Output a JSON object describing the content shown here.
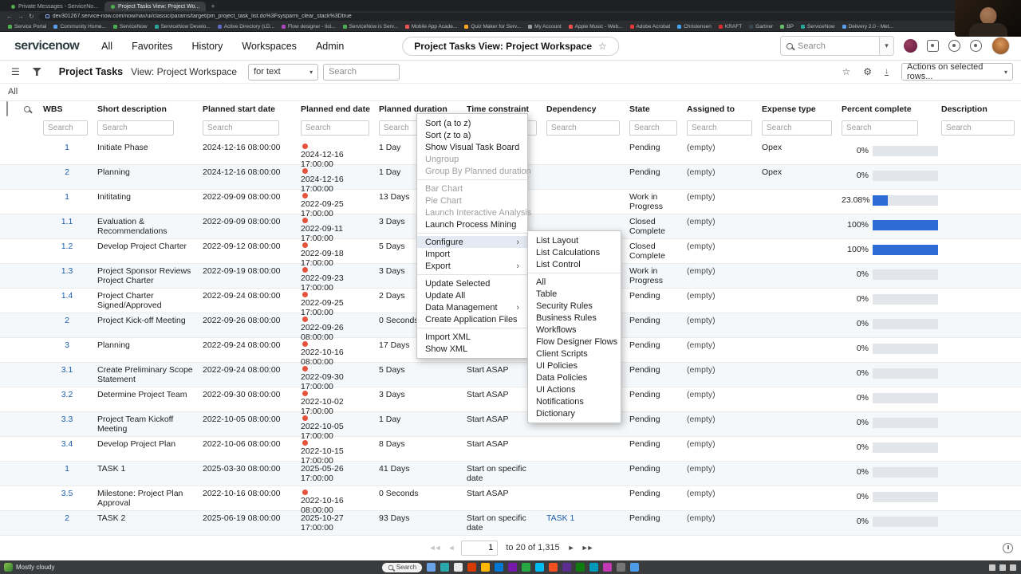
{
  "colors": {
    "link_blue": "#1a5dab",
    "progress_bar_blue": "#2e6bd6",
    "overdue_dot_red": "#e5533c",
    "brand_dark": "#2e3d40",
    "menu_highlight": "#e4eaf3"
  },
  "icons": {
    "menu": "☰",
    "gear": "⚙",
    "star": "☆",
    "caret": "▾",
    "back": "←",
    "forward": "→",
    "refresh": "↻",
    "download": "↓",
    "plus": "+",
    "submenu_arrow": "›",
    "first_page": "◄◄",
    "prev_page": "◄",
    "next_page": "►",
    "last_page": "►►"
  },
  "browser": {
    "tabs": [
      {
        "label": "Private Messages - ServiceNo...",
        "active": false
      },
      {
        "label": "Project Tasks View: Project Wo...",
        "active": true
      }
    ],
    "url": "dev301267.service-now.com/now/nav/ui/classic/params/target/pm_project_task_list.do%3Fsysparm_clear_stack%3Dtrue",
    "bookmarks": [
      {
        "label": "Service Portal",
        "color": "#4caf50"
      },
      {
        "label": "Community Home...",
        "color": "#5c9ded"
      },
      {
        "label": "ServiceNow",
        "color": "#4caf50"
      },
      {
        "label": "ServiceNow Develo...",
        "color": "#26a69a"
      },
      {
        "label": "Active Directory (LD...",
        "color": "#5c6bc0"
      },
      {
        "label": "Flow designer - list...",
        "color": "#ab47bc"
      },
      {
        "label": "ServiceNow is Serv...",
        "color": "#4caf50"
      },
      {
        "label": "Mobile App Acade...",
        "color": "#ef5350"
      },
      {
        "label": "Quiz Maker for Serv...",
        "color": "#ffa726"
      },
      {
        "label": "My Account",
        "color": "#9e9e9e"
      },
      {
        "label": "Apple Music - Web...",
        "color": "#ef5350"
      },
      {
        "label": "Adobe Acrobat",
        "color": "#e53935"
      },
      {
        "label": "Christensen",
        "color": "#42a5f5"
      },
      {
        "label": "KRAFT",
        "color": "#d32f2f"
      },
      {
        "label": "Gartner",
        "color": "#37474f"
      },
      {
        "label": "BP",
        "color": "#66bb6a"
      },
      {
        "label": "ServiceNow",
        "color": "#26a69a"
      },
      {
        "label": "Delivery 2.0 - Met...",
        "color": "#5c9ded"
      }
    ]
  },
  "header": {
    "logo": "servicenow",
    "nav": [
      "All",
      "Favorites",
      "History",
      "Workspaces",
      "Admin"
    ],
    "title_pill": "Project Tasks View: Project Workspace",
    "search_placeholder": "Search"
  },
  "toolbar": {
    "list_title": "Project Tasks",
    "view_label": "View: Project Workspace",
    "search_type": "for text",
    "search_placeholder": "Search",
    "actions_dropdown": "Actions on selected rows..."
  },
  "list": {
    "breadcrumb": "All",
    "filter_placeholder": "Search",
    "columns": [
      "WBS",
      "Short description",
      "Planned start date",
      "Planned end date",
      "Planned duration",
      "Time constraint",
      "Dependency",
      "State",
      "Assigned to",
      "Expense type",
      "Percent complete",
      "Description"
    ],
    "rows": [
      {
        "wbs": "1",
        "desc": "Initiate Phase",
        "start": "2024-12-16 08:00:00",
        "end": "2024-12-16 17:00:00",
        "overdue": true,
        "duration": "1 Day",
        "constraint": "",
        "dependency": "",
        "state": "Pending",
        "assigned": "(empty)",
        "expense": "Opex",
        "percent_label": "0%",
        "percent_value": 0
      },
      {
        "wbs": "2",
        "desc": "Planning",
        "start": "2024-12-16 08:00:00",
        "end": "2024-12-16 17:00:00",
        "overdue": true,
        "duration": "1 Day",
        "constraint": "",
        "dependency": "",
        "state": "Pending",
        "assigned": "(empty)",
        "expense": "Opex",
        "percent_label": "0%",
        "percent_value": 0
      },
      {
        "wbs": "1",
        "desc": "Inititating",
        "start": "2022-09-09 08:00:00",
        "end": "2022-09-25 17:00:00",
        "overdue": true,
        "duration": "13 Days",
        "constraint": "",
        "dependency": "",
        "state": "Work in Progress",
        "assigned": "(empty)",
        "expense": "",
        "percent_label": "23.08%",
        "percent_value": 23.08
      },
      {
        "wbs": "1.1",
        "desc": "Evaluation & Recommendations",
        "start": "2022-09-09 08:00:00",
        "end": "2022-09-11 17:00:00",
        "overdue": true,
        "duration": "3 Days",
        "constraint": "",
        "dependency": "",
        "state": "Closed Complete",
        "assigned": "(empty)",
        "expense": "",
        "percent_label": "100%",
        "percent_value": 100
      },
      {
        "wbs": "1.2",
        "desc": "Develop Project Charter",
        "start": "2022-09-12 08:00:00",
        "end": "2022-09-18 17:00:00",
        "overdue": true,
        "duration": "5 Days",
        "constraint": "",
        "dependency": "",
        "state": "Closed Complete",
        "assigned": "(empty)",
        "expense": "",
        "percent_label": "100%",
        "percent_value": 100
      },
      {
        "wbs": "1.3",
        "desc": "Project Sponsor Reviews Project Charter",
        "start": "2022-09-19 08:00:00",
        "end": "2022-09-23 17:00:00",
        "overdue": true,
        "duration": "3 Days",
        "constraint": "",
        "dependency": "",
        "state": "Work in Progress",
        "assigned": "(empty)",
        "expense": "",
        "percent_label": "0%",
        "percent_value": 0
      },
      {
        "wbs": "1.4",
        "desc": "Project Charter Signed/Approved",
        "start": "2022-09-24 08:00:00",
        "end": "2022-09-25 17:00:00",
        "overdue": true,
        "duration": "2 Days",
        "constraint": "",
        "dependency": "",
        "state": "Pending",
        "assigned": "(empty)",
        "expense": "",
        "percent_label": "0%",
        "percent_value": 0
      },
      {
        "wbs": "2",
        "desc": "Project Kick-off Meeting",
        "start": "2022-09-26 08:00:00",
        "end": "2022-09-26 08:00:00",
        "overdue": true,
        "duration": "0 Seconds",
        "constraint": "",
        "dependency": "",
        "state": "Pending",
        "assigned": "(empty)",
        "expense": "",
        "percent_label": "0%",
        "percent_value": 0
      },
      {
        "wbs": "3",
        "desc": "Planning",
        "start": "2022-09-24 08:00:00",
        "end": "2022-10-16 08:00:00",
        "overdue": true,
        "duration": "17 Days",
        "constraint": "Start ASAP",
        "dependency": "",
        "state": "Pending",
        "assigned": "(empty)",
        "expense": "",
        "percent_label": "0%",
        "percent_value": 0
      },
      {
        "wbs": "3.1",
        "desc": "Create Preliminary Scope Statement",
        "start": "2022-09-24 08:00:00",
        "end": "2022-09-30 17:00:00",
        "overdue": true,
        "duration": "5 Days",
        "constraint": "Start ASAP",
        "dependency": "",
        "state": "Pending",
        "assigned": "(empty)",
        "expense": "",
        "percent_label": "0%",
        "percent_value": 0
      },
      {
        "wbs": "3.2",
        "desc": "Determine Project Team",
        "start": "2022-09-30 08:00:00",
        "end": "2022-10-02 17:00:00",
        "overdue": true,
        "duration": "3 Days",
        "constraint": "Start ASAP",
        "dependency": "",
        "state": "Pending",
        "assigned": "(empty)",
        "expense": "",
        "percent_label": "0%",
        "percent_value": 0
      },
      {
        "wbs": "3.3",
        "desc": "Project Team Kickoff Meeting",
        "start": "2022-10-05 08:00:00",
        "end": "2022-10-05 17:00:00",
        "overdue": true,
        "duration": "1 Day",
        "constraint": "Start ASAP",
        "dependency": "",
        "state": "Pending",
        "assigned": "(empty)",
        "expense": "",
        "percent_label": "0%",
        "percent_value": 0
      },
      {
        "wbs": "3.4",
        "desc": "Develop Project Plan",
        "start": "2022-10-06 08:00:00",
        "end": "2022-10-15 17:00:00",
        "overdue": true,
        "duration": "8 Days",
        "constraint": "Start ASAP",
        "dependency": "",
        "state": "Pending",
        "assigned": "(empty)",
        "expense": "",
        "percent_label": "0%",
        "percent_value": 0
      },
      {
        "wbs": "1",
        "desc": "TASK 1",
        "start": "2025-03-30 08:00:00",
        "end": "2025-05-26 17:00:00",
        "overdue": false,
        "duration": "41 Days",
        "constraint": "Start on specific date",
        "dependency": "",
        "state": "Pending",
        "assigned": "(empty)",
        "expense": "",
        "percent_label": "0%",
        "percent_value": 0
      },
      {
        "wbs": "3.5",
        "desc": "Milestone: Project Plan Approval",
        "start": "2022-10-16 08:00:00",
        "end": "2022-10-16 08:00:00",
        "overdue": true,
        "duration": "0 Seconds",
        "constraint": "Start ASAP",
        "dependency": "",
        "state": "Pending",
        "assigned": "(empty)",
        "expense": "",
        "percent_label": "0%",
        "percent_value": 0
      },
      {
        "wbs": "2",
        "desc": "TASK 2",
        "start": "2025-06-19 08:00:00",
        "end": "2025-10-27 17:00:00",
        "overdue": false,
        "duration": "93 Days",
        "constraint": "Start on specific date",
        "dependency": "TASK 1",
        "state": "Pending",
        "assigned": "(empty)",
        "expense": "",
        "percent_label": "0%",
        "percent_value": 0
      }
    ]
  },
  "context_menu": {
    "items": [
      {
        "label": "Sort (a to z)"
      },
      {
        "label": "Sort (z to a)"
      },
      {
        "label": "Show Visual Task Board"
      },
      {
        "label": "Ungroup",
        "disabled": true
      },
      {
        "label": "Group By Planned duration",
        "disabled": true
      },
      {
        "separator": true
      },
      {
        "label": "Bar Chart",
        "disabled": true
      },
      {
        "label": "Pie Chart",
        "disabled": true
      },
      {
        "label": "Launch Interactive Analysis",
        "disabled": true
      },
      {
        "label": "Launch Process Mining"
      },
      {
        "separator": true
      },
      {
        "label": "Configure",
        "has_submenu": true,
        "highlighted": true
      },
      {
        "label": "Import"
      },
      {
        "label": "Export",
        "has_submenu": true
      },
      {
        "separator": true
      },
      {
        "label": "Update Selected"
      },
      {
        "label": "Update All"
      },
      {
        "label": "Data Management",
        "has_submenu": true
      },
      {
        "label": "Create Application Files"
      },
      {
        "separator": true
      },
      {
        "label": "Import XML"
      },
      {
        "label": "Show XML"
      }
    ]
  },
  "configure_submenu": {
    "items": [
      {
        "label": "List Layout"
      },
      {
        "label": "List Calculations"
      },
      {
        "label": "List Control"
      },
      {
        "separator": true
      },
      {
        "label": "All"
      },
      {
        "label": "Table"
      },
      {
        "label": "Security Rules"
      },
      {
        "label": "Business Rules"
      },
      {
        "label": "Workflows"
      },
      {
        "label": "Flow Designer Flows"
      },
      {
        "label": "Client Scripts"
      },
      {
        "label": "UI Policies"
      },
      {
        "label": "Data Policies"
      },
      {
        "label": "UI Actions"
      },
      {
        "label": "Notifications"
      },
      {
        "label": "Dictionary"
      }
    ]
  },
  "pagination": {
    "page": "1",
    "range": "to 20 of 1,315"
  },
  "taskbar": {
    "search": "Search",
    "weather": "Mostly cloudy",
    "apps": [
      {
        "color": "#6aa3e8"
      },
      {
        "color": "#29a8ab"
      },
      {
        "color": "#e8e8e8"
      },
      {
        "color": "#d83b01"
      },
      {
        "color": "#ffb900"
      },
      {
        "color": "#0078d4"
      },
      {
        "color": "#7719aa"
      },
      {
        "color": "#28a745"
      },
      {
        "color": "#00bcf2"
      },
      {
        "color": "#f25022"
      },
      {
        "color": "#5c2d91"
      },
      {
        "color": "#107c10"
      },
      {
        "color": "#0099bc"
      },
      {
        "color": "#c239b3"
      },
      {
        "color": "#767676"
      },
      {
        "color": "#4c9ce8"
      }
    ]
  }
}
